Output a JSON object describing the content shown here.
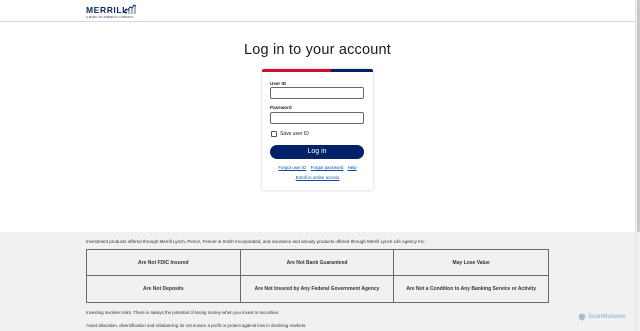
{
  "header": {
    "logo_text": "MERRILL",
    "logo_subtext": "A BANK OF AMERICA COMPANY"
  },
  "page": {
    "title": "Log in to your account"
  },
  "login": {
    "user_id_label": "User ID",
    "user_id_value": "",
    "password_label": "Password",
    "password_value": "",
    "save_user_id_label": "Save user ID",
    "save_user_id_checked": false,
    "login_button": "Log in",
    "forgot_user_id": "Forgot user ID",
    "forgot_password": "Forgot password",
    "help": "Help",
    "enroll": "Enroll in online access"
  },
  "footer": {
    "disclaimer": "Investment products offered through Merrill Lynch, Pierce, Fenner & Smith Incorporated, and insurance and annuity products offered through Merrill Lynch Life Agency Inc.:",
    "table": [
      "Are Not FDIC Insured",
      "Are Not Bank Guaranteed",
      "May Lose Value",
      "Are Not Deposits",
      "Are Not Insured by Any Federal Government Agency",
      "Are Not a Condition to Any Banking Service or Activity"
    ],
    "note1": "Investing involves risks. There is always the potential of losing money when you invest in securities.",
    "note2": "Asset allocation, diversification and rebalancing do not ensure a profit or protect against loss in declining markets."
  },
  "watermark": {
    "text": "ScanMalware"
  },
  "colors": {
    "brand_blue": "#012169",
    "brand_red": "#c8102e",
    "link": "#0b4ea2"
  }
}
